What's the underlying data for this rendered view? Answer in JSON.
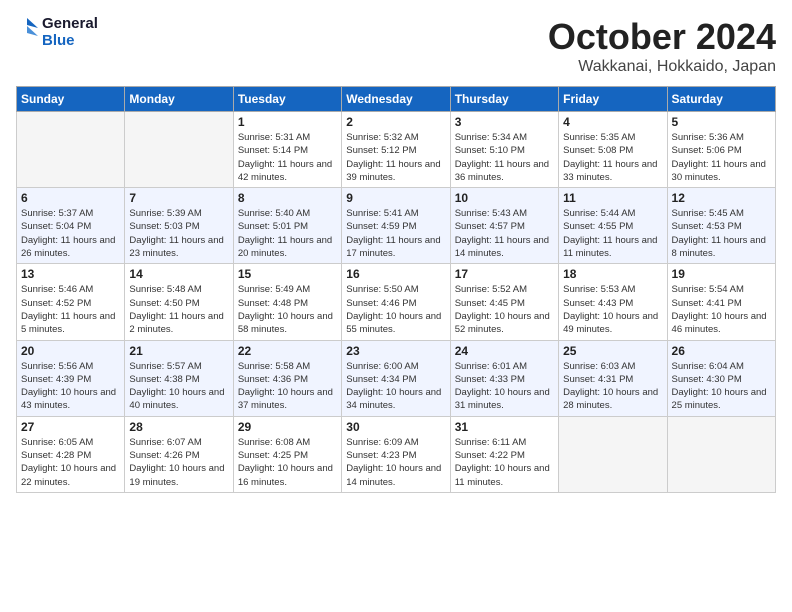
{
  "header": {
    "logo_general": "General",
    "logo_blue": "Blue",
    "month": "October 2024",
    "location": "Wakkanai, Hokkaido, Japan"
  },
  "weekdays": [
    "Sunday",
    "Monday",
    "Tuesday",
    "Wednesday",
    "Thursday",
    "Friday",
    "Saturday"
  ],
  "weeks": [
    [
      {
        "day": "",
        "info": ""
      },
      {
        "day": "",
        "info": ""
      },
      {
        "day": "1",
        "info": "Sunrise: 5:31 AM\nSunset: 5:14 PM\nDaylight: 11 hours and 42 minutes."
      },
      {
        "day": "2",
        "info": "Sunrise: 5:32 AM\nSunset: 5:12 PM\nDaylight: 11 hours and 39 minutes."
      },
      {
        "day": "3",
        "info": "Sunrise: 5:34 AM\nSunset: 5:10 PM\nDaylight: 11 hours and 36 minutes."
      },
      {
        "day": "4",
        "info": "Sunrise: 5:35 AM\nSunset: 5:08 PM\nDaylight: 11 hours and 33 minutes."
      },
      {
        "day": "5",
        "info": "Sunrise: 5:36 AM\nSunset: 5:06 PM\nDaylight: 11 hours and 30 minutes."
      }
    ],
    [
      {
        "day": "6",
        "info": "Sunrise: 5:37 AM\nSunset: 5:04 PM\nDaylight: 11 hours and 26 minutes."
      },
      {
        "day": "7",
        "info": "Sunrise: 5:39 AM\nSunset: 5:03 PM\nDaylight: 11 hours and 23 minutes."
      },
      {
        "day": "8",
        "info": "Sunrise: 5:40 AM\nSunset: 5:01 PM\nDaylight: 11 hours and 20 minutes."
      },
      {
        "day": "9",
        "info": "Sunrise: 5:41 AM\nSunset: 4:59 PM\nDaylight: 11 hours and 17 minutes."
      },
      {
        "day": "10",
        "info": "Sunrise: 5:43 AM\nSunset: 4:57 PM\nDaylight: 11 hours and 14 minutes."
      },
      {
        "day": "11",
        "info": "Sunrise: 5:44 AM\nSunset: 4:55 PM\nDaylight: 11 hours and 11 minutes."
      },
      {
        "day": "12",
        "info": "Sunrise: 5:45 AM\nSunset: 4:53 PM\nDaylight: 11 hours and 8 minutes."
      }
    ],
    [
      {
        "day": "13",
        "info": "Sunrise: 5:46 AM\nSunset: 4:52 PM\nDaylight: 11 hours and 5 minutes."
      },
      {
        "day": "14",
        "info": "Sunrise: 5:48 AM\nSunset: 4:50 PM\nDaylight: 11 hours and 2 minutes."
      },
      {
        "day": "15",
        "info": "Sunrise: 5:49 AM\nSunset: 4:48 PM\nDaylight: 10 hours and 58 minutes."
      },
      {
        "day": "16",
        "info": "Sunrise: 5:50 AM\nSunset: 4:46 PM\nDaylight: 10 hours and 55 minutes."
      },
      {
        "day": "17",
        "info": "Sunrise: 5:52 AM\nSunset: 4:45 PM\nDaylight: 10 hours and 52 minutes."
      },
      {
        "day": "18",
        "info": "Sunrise: 5:53 AM\nSunset: 4:43 PM\nDaylight: 10 hours and 49 minutes."
      },
      {
        "day": "19",
        "info": "Sunrise: 5:54 AM\nSunset: 4:41 PM\nDaylight: 10 hours and 46 minutes."
      }
    ],
    [
      {
        "day": "20",
        "info": "Sunrise: 5:56 AM\nSunset: 4:39 PM\nDaylight: 10 hours and 43 minutes."
      },
      {
        "day": "21",
        "info": "Sunrise: 5:57 AM\nSunset: 4:38 PM\nDaylight: 10 hours and 40 minutes."
      },
      {
        "day": "22",
        "info": "Sunrise: 5:58 AM\nSunset: 4:36 PM\nDaylight: 10 hours and 37 minutes."
      },
      {
        "day": "23",
        "info": "Sunrise: 6:00 AM\nSunset: 4:34 PM\nDaylight: 10 hours and 34 minutes."
      },
      {
        "day": "24",
        "info": "Sunrise: 6:01 AM\nSunset: 4:33 PM\nDaylight: 10 hours and 31 minutes."
      },
      {
        "day": "25",
        "info": "Sunrise: 6:03 AM\nSunset: 4:31 PM\nDaylight: 10 hours and 28 minutes."
      },
      {
        "day": "26",
        "info": "Sunrise: 6:04 AM\nSunset: 4:30 PM\nDaylight: 10 hours and 25 minutes."
      }
    ],
    [
      {
        "day": "27",
        "info": "Sunrise: 6:05 AM\nSunset: 4:28 PM\nDaylight: 10 hours and 22 minutes."
      },
      {
        "day": "28",
        "info": "Sunrise: 6:07 AM\nSunset: 4:26 PM\nDaylight: 10 hours and 19 minutes."
      },
      {
        "day": "29",
        "info": "Sunrise: 6:08 AM\nSunset: 4:25 PM\nDaylight: 10 hours and 16 minutes."
      },
      {
        "day": "30",
        "info": "Sunrise: 6:09 AM\nSunset: 4:23 PM\nDaylight: 10 hours and 14 minutes."
      },
      {
        "day": "31",
        "info": "Sunrise: 6:11 AM\nSunset: 4:22 PM\nDaylight: 10 hours and 11 minutes."
      },
      {
        "day": "",
        "info": ""
      },
      {
        "day": "",
        "info": ""
      }
    ]
  ]
}
